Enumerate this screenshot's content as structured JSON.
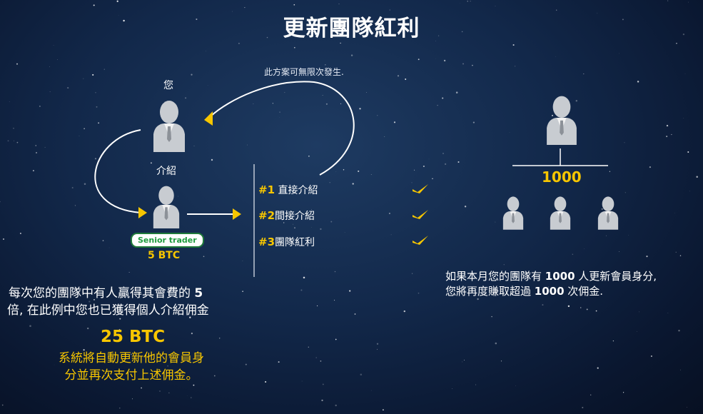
{
  "title": "更新團隊紅利",
  "loop_note": "此方案可無限次發生.",
  "you_label": "您",
  "referral_label": "介紹",
  "badge": "Senior trader",
  "referral_amount": "5 BTC",
  "bonus_list": [
    {
      "num": "#1",
      "text": "直接介紹"
    },
    {
      "num": "#2",
      "text": "間接介紹"
    },
    {
      "num": "#3",
      "text": "團隊紅利"
    }
  ],
  "left_para": {
    "line1_pre": "每次您的團隊中有人贏得其會費的 ",
    "line1_bold": "5",
    "line2": "倍, 在此例中您也已獲得個人介紹佣金"
  },
  "total": "25 BTC",
  "auto_note": {
    "line1": "系統將自動更新他的會員身",
    "line2": "分並再次支付上述佣金。"
  },
  "team_count": "1000",
  "right_para": {
    "l1_pre": "如果本月您的團隊有 ",
    "l1_bold": "1000",
    "l1_post": " 人更新會員身分,",
    "l2_pre": "您將再度賺取超過 ",
    "l2_bold": "1000",
    "l2_post": " 次佣金."
  },
  "colors": {
    "accent": "#f7c600",
    "background": "#12284a",
    "badge_green": "#1e9b3d"
  },
  "icons": [
    "person-icon",
    "check-icon"
  ]
}
